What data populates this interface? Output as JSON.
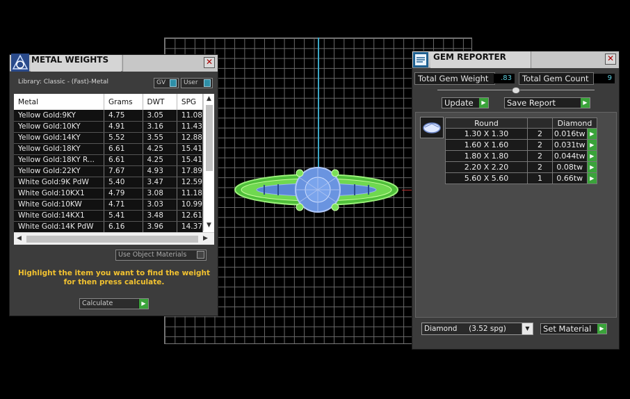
{
  "metal_panel": {
    "title": "METAL WEIGHTS",
    "library_label": "Library: Classic - (Fast)-Metal",
    "toggle_gv": "GV",
    "toggle_user": "User",
    "columns": [
      "Metal",
      "Grams",
      "DWT",
      "SPG"
    ],
    "rows": [
      [
        "Yellow Gold:9KY",
        "4.75",
        "3.05",
        "11.08"
      ],
      [
        "Yellow Gold:10KY",
        "4.91",
        "3.16",
        "11.43"
      ],
      [
        "Yellow Gold:14KY",
        "5.52",
        "3.55",
        "12.88"
      ],
      [
        "Yellow Gold:18KY",
        "6.61",
        "4.25",
        "15.41"
      ],
      [
        "Yellow Gold:18KY R...",
        "6.61",
        "4.25",
        "15.41"
      ],
      [
        "Yellow Gold:22KY",
        "7.67",
        "4.93",
        "17.89"
      ],
      [
        "White Gold:9K PdW",
        "5.40",
        "3.47",
        "12.59"
      ],
      [
        "White Gold:10KX1",
        "4.79",
        "3.08",
        "11.18"
      ],
      [
        "White Gold:10KW",
        "4.71",
        "3.03",
        "10.99"
      ],
      [
        "White Gold:14KX1",
        "5.41",
        "3.48",
        "12.61"
      ],
      [
        "White Gold:14K PdW",
        "6.16",
        "3.96",
        "14.37"
      ]
    ],
    "use_materials_label": "Use Object Materials",
    "hint": "Highlight the item you want to find the weight for then press calculate.",
    "calculate_label": "Calculate"
  },
  "gem_panel": {
    "title": "GEM REPORTER",
    "total_weight_label": "Total Gem Weight",
    "total_weight_value": ".83",
    "total_count_label": "Total Gem Count",
    "total_count_value": "9",
    "update_label": "Update",
    "save_report_label": "Save Report",
    "table_headers": [
      "Round",
      "",
      "Diamond"
    ],
    "table_rows": [
      [
        "1.30 X 1.30",
        "2",
        "0.016tw"
      ],
      [
        "1.60 X 1.60",
        "2",
        "0.031tw"
      ],
      [
        "1.80 X 1.80",
        "2",
        "0.044tw"
      ],
      [
        "2.20 X 2.20",
        "2",
        "0.08tw"
      ],
      [
        "5.60 X 5.60",
        "1",
        "0.66tw"
      ]
    ],
    "material_select": "Diamond     (3.52 spg)",
    "set_material_label": "Set Material"
  },
  "colors": {
    "accent_green": "#3aa33a",
    "hint_yellow": "#f2c230",
    "value_cyan": "#5fd0e0"
  }
}
